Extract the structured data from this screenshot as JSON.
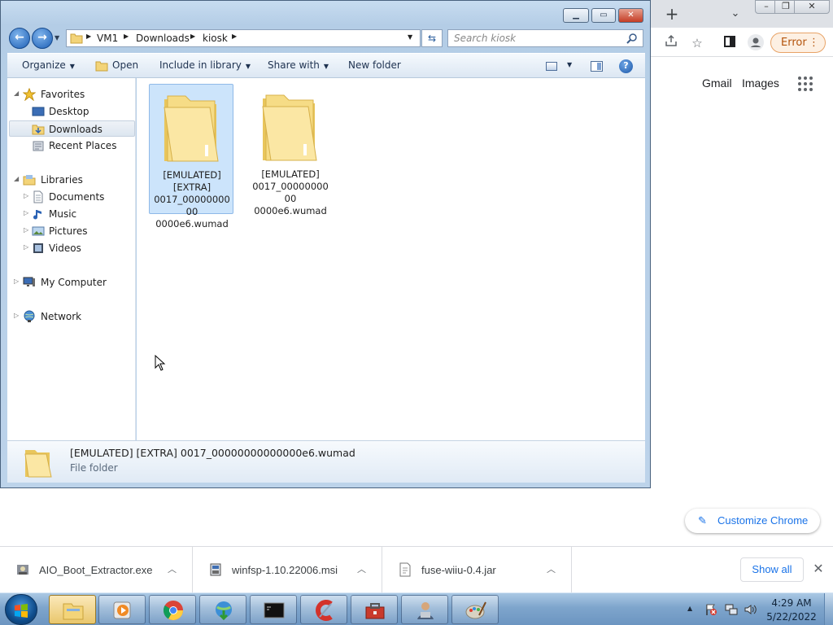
{
  "chrome": {
    "new_tab_symbol": "+",
    "tab_search_icon": "chevron-down-icon",
    "window_buttons": [
      "minimize",
      "restore",
      "close"
    ],
    "toolbar_icons": [
      "share-icon",
      "bookmark-star-icon",
      "side-panel-icon",
      "profile-icon"
    ],
    "error_label": "Error",
    "gmail_link": "Gmail",
    "images_link": "Images",
    "apps_icon": "apps-grid-icon",
    "customize_label": "Customize Chrome",
    "downloads": [
      {
        "name": "AIO_Boot_Extractor.exe",
        "icon": "exe-icon"
      },
      {
        "name": "winfsp-1.10.22006.msi",
        "icon": "msi-installer-icon"
      },
      {
        "name": "fuse-wiiu-0.4.jar",
        "icon": "jar-file-icon"
      }
    ],
    "show_all_label": "Show all"
  },
  "explorer": {
    "breadcrumb": [
      "VM1",
      "Downloads",
      "kiosk"
    ],
    "search_placeholder": "Search kiosk",
    "commands": {
      "organize": "Organize",
      "open": "Open",
      "include_in_library": "Include in library",
      "share_with": "Share with",
      "new_folder": "New folder"
    },
    "nav": {
      "favorites": "Favorites",
      "desktop": "Desktop",
      "downloads": "Downloads",
      "recent_places": "Recent Places",
      "libraries": "Libraries",
      "documents": "Documents",
      "music": "Music",
      "pictures": "Pictures",
      "videos": "Videos",
      "my_computer": "My Computer",
      "network": "Network",
      "selected": "Downloads"
    },
    "files": [
      {
        "name": "[EMULATED] [EXTRA] 0017_00000000000000e6.wumad",
        "lines": [
          "[EMULATED]",
          "[EXTRA]",
          "0017_0000000000",
          "0000e6.wumad"
        ],
        "selected": true
      },
      {
        "name": "[EMULATED] 0017_00000000000000e6.wumad",
        "lines": [
          "[EMULATED]",
          "0017_0000000000",
          "0000e6.wumad"
        ],
        "selected": false
      }
    ],
    "details": {
      "name": "[EMULATED] [EXTRA] 0017_00000000000000e6.wumad",
      "type": "File folder"
    }
  },
  "taskbar": {
    "pinned": [
      "windows-explorer-icon",
      "media-player-icon",
      "chrome-icon",
      "download-manager-icon",
      "command-prompt-icon",
      "ccleaner-icon",
      "toolbox-icon",
      "user-app-icon",
      "paint-icon"
    ],
    "active": "windows-explorer-icon",
    "tray_icons": [
      "action-center-flag-icon",
      "network-icon",
      "volume-icon"
    ],
    "time": "4:29 AM",
    "date": "5/22/2022"
  }
}
